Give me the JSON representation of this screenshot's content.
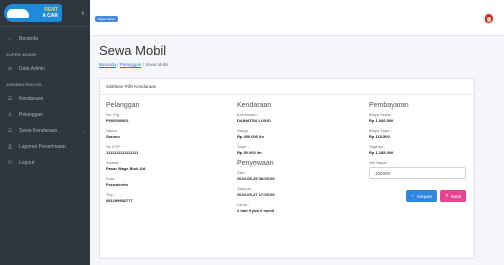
{
  "brand": {
    "line1": "RENT",
    "line2": "A CAR",
    "toggle": "‹"
  },
  "sidebar": {
    "items_top": [
      {
        "icon": "⌂",
        "label": "Beranda"
      }
    ],
    "header_super": "SUPER ADMIN",
    "items_super": [
      {
        "icon": "⚙",
        "label": "Data Admin"
      }
    ],
    "header_admin": "ADMINISTRATOR",
    "items_admin": [
      {
        "icon": "☰",
        "label": "Kendaraan"
      },
      {
        "icon": "♙",
        "label": "Pelanggan"
      },
      {
        "icon": "☷",
        "label": "Sewa Kendaraan",
        "caret": "‹"
      },
      {
        "icon": "⎙",
        "label": "Laporan Penerimaan"
      },
      {
        "icon": "⏻",
        "label": "Logout"
      }
    ]
  },
  "topbar": {
    "badge": "Super Admin"
  },
  "page": {
    "title": "Sewa Mobil",
    "breadcrumb": {
      "home": "Beranda",
      "sep1": " / ",
      "link": "Pelanggan",
      "sep2": " / ",
      "current": "Sewa Mobil"
    }
  },
  "card": {
    "header": "Silahkan Pilih Kendaraan",
    "pelanggan": {
      "title": "Pelanggan",
      "no_plg_label": "No. Plg :",
      "no_plg": "P000000001",
      "nama_label": "Nama :",
      "nama": "Sarono",
      "ktp_label": "No KTP :",
      "ktp": "1111111111111111",
      "alamat_label": "Alamat :",
      "alamat": "Pasar Wage Blok 4/A",
      "kota_label": "Kota :",
      "kota": "Purwokerto",
      "telp_label": "Telp :",
      "telp": "081299982777"
    },
    "kendaraan": {
      "title": "Kendaraan",
      "kendaraan_label": "Kendaraan :",
      "kendaraan": "DAIHATSU LUXIO",
      "harga_label": "Harga :",
      "harga": "Rp 450.000 /hr",
      "supir_label": "Supir :",
      "supir": "Rp 50.000 /hr"
    },
    "penyewaan": {
      "title": "Penyewaan",
      "dari_label": "Dari :",
      "dari": "2023-05-25 08:00:00",
      "sampai_label": "Sampai :",
      "sampai": "2023-05-27 17:00:00",
      "lama_label": "Lama :",
      "lama": "2 hari 9 jam 0 menit"
    },
    "pembayaran": {
      "title": "Pembayaran",
      "biaya_sewa_label": "Biaya Sewa :",
      "biaya_sewa": "Rp 1.066.500",
      "biaya_supir_label": "Biaya Supir :",
      "biaya_supir": "Rp 118.500",
      "tagihan_label": "Tagihan :",
      "tagihan": "Rp 1.185.000",
      "jml_bayar_label": "Jml Bayar",
      "jml_bayar_value": "100000",
      "save_label": "Simpan",
      "cancel_label": "Batal"
    }
  }
}
